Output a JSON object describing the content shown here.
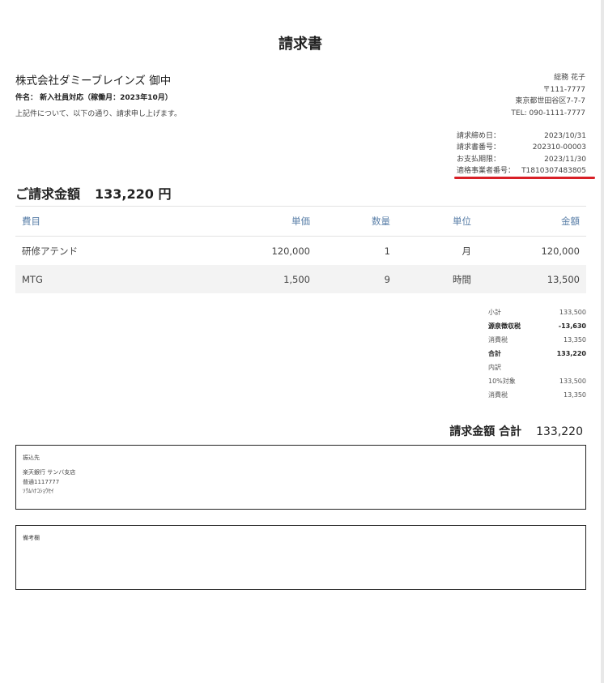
{
  "title": "請求書",
  "client": "株式会社ダミーブレインズ 御中",
  "subject": "件名： 新入社員対応（稼働月：2023年10月）",
  "note": "上記件について、以下の通り、請求申し上げます。",
  "sender": {
    "name": "総務 花子",
    "zip": "〒111-7777",
    "address": "東京都世田谷区7-7-7",
    "tel": "TEL: 090-1111-7777"
  },
  "meta": [
    {
      "label": "請求締め日：",
      "value": "2023/10/31"
    },
    {
      "label": "請求書番号：",
      "value": "202310-00003"
    },
    {
      "label": "お支払期限：",
      "value": "2023/11/30"
    },
    {
      "label": "適格事業者番号：",
      "value": "T1810307483805"
    }
  ],
  "total_heading": {
    "label": "ご請求金額",
    "value": "133,220 円"
  },
  "table": {
    "headers": [
      "費目",
      "単価",
      "数量",
      "単位",
      "金額"
    ],
    "rows": [
      [
        "研修アテンド",
        "120,000",
        "1",
        "月",
        "120,000"
      ],
      [
        "MTG",
        "1,500",
        "9",
        "時間",
        "13,500"
      ]
    ]
  },
  "summary": [
    {
      "label": "小計",
      "value": "133,500"
    },
    {
      "label": "源泉徴収税",
      "value": "-13,630"
    },
    {
      "label": "消費税",
      "value": "13,350"
    },
    {
      "label": "合計",
      "value": "133,220"
    },
    {
      "label": "内訳",
      "value": ""
    },
    {
      "label": "10%対象",
      "value": "133,500"
    },
    {
      "label": "消費税",
      "value": "13,350"
    }
  ],
  "grand_total": {
    "label": "請求金額 合計",
    "value": "133,220"
  },
  "bank_box": {
    "heading": "振込先",
    "lines": [
      "楽天銀行 サンバ支店",
      "普通1117777",
      "ｿｳﾑﾊﾅｺｼｮｳｾｲ"
    ]
  },
  "remarks_box": {
    "heading": "備考欄"
  },
  "colors": {
    "accent_red": "#d81f26",
    "header_blue": "#5a7fa8"
  }
}
